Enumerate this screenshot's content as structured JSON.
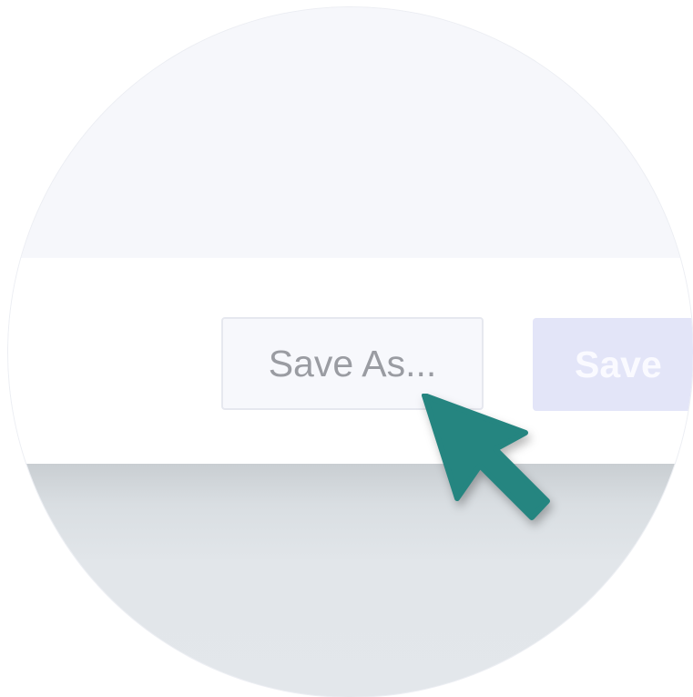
{
  "footer": {
    "save_as_label": "Save As...",
    "save_label": "Save"
  },
  "cursor": {
    "icon": "arrow-pointer-icon",
    "color": "#258580"
  },
  "colors": {
    "accent_disabled": "#e3e5f8",
    "panel_background": "#f6f7fb"
  }
}
